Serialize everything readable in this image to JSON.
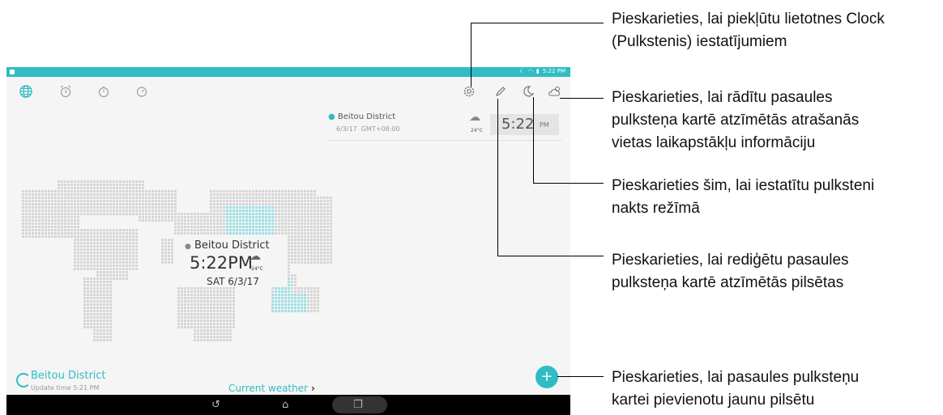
{
  "status_bar": {
    "time": "5:22 PM"
  },
  "toolbar": {
    "tabs": [
      {
        "name": "world-clock",
        "icon": "globe-icon",
        "active": true
      },
      {
        "name": "alarm",
        "icon": "alarm-clock-icon",
        "active": false
      },
      {
        "name": "stopwatch",
        "icon": "stopwatch-icon",
        "active": false
      },
      {
        "name": "timer",
        "icon": "timer-icon",
        "active": false
      }
    ],
    "actions": [
      "settings-gear-icon",
      "edit-pencil-icon",
      "night-moon-icon",
      "weather-icon"
    ]
  },
  "city_card": {
    "city": "Beitou District",
    "date": "6/3/17",
    "gmt": "GMT+08:00",
    "temp": "24°C",
    "time": "5:22",
    "ampm": "PM"
  },
  "map": {
    "city": "Beitou District",
    "time": "5:22PM",
    "temp": "24°C",
    "date": "SAT 6/3/17"
  },
  "bottom": {
    "city": "Beitou District",
    "update": "Update time 5:21 PM",
    "current_weather": "Current weather"
  },
  "callouts": {
    "settings_line1": "Pieskarieties, lai piekļūtu lietotnes Clock",
    "settings_line2": "(Pulkstenis) iestatījumiem",
    "weather_line1": "Pieskarieties, lai rādītu pasaules",
    "weather_line2": "pulksteņa kartē atzīmētās atrašanās",
    "weather_line3": "vietas laikapstākļu informāciju",
    "night_line1": "Pieskarieties šim, lai iestatītu pulksteni",
    "night_line2": "nakts režīmā",
    "edit_line1": "Pieskarieties, lai rediģētu pasaules",
    "edit_line2": "pulksteņa kartē atzīmētās pilsētas",
    "add_line1": "Pieskarieties, lai pasaules pulksteņu",
    "add_line2": "kartei pievienotu jaunu pilsētu"
  },
  "colors": {
    "accent": "#2fbcc4",
    "navbar": "#000000"
  }
}
